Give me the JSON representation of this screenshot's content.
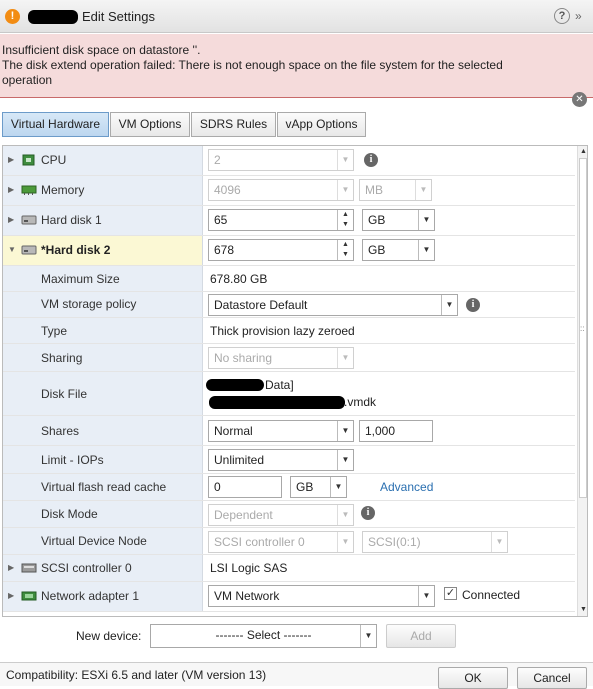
{
  "window": {
    "title": "Edit Settings"
  },
  "error": {
    "line1": "Insufficient disk space on datastore ''.",
    "line2": "The disk extend operation failed: There is not enough space on the file system for the selected operation"
  },
  "tabs": [
    "Virtual Hardware",
    "VM Options",
    "SDRS Rules",
    "vApp Options"
  ],
  "hardware": {
    "cpu": {
      "label": "CPU",
      "value": "2"
    },
    "memory": {
      "label": "Memory",
      "value": "4096",
      "unit": "MB"
    },
    "hard_disk_1": {
      "label": "Hard disk 1",
      "value": "65",
      "unit": "GB"
    },
    "hard_disk_2": {
      "label": "*Hard disk 2",
      "value": "678",
      "unit": "GB",
      "max_size_label": "Maximum Size",
      "max_size_value": "678.80 GB",
      "storage_policy_label": "VM storage policy",
      "storage_policy_value": "Datastore Default",
      "type_label": "Type",
      "type_value": "Thick provision lazy zeroed",
      "sharing_label": "Sharing",
      "sharing_value": "No sharing",
      "disk_file_label": "Disk File",
      "disk_file_line1": "Data]",
      "disk_file_line2": ".vmdk",
      "shares_label": "Shares",
      "shares_value": "Normal",
      "shares_number": "1,000",
      "limit_label": "Limit - IOPs",
      "limit_value": "Unlimited",
      "flash_label": "Virtual flash read cache",
      "flash_value": "0",
      "flash_unit": "GB",
      "advanced_link": "Advanced",
      "disk_mode_label": "Disk Mode",
      "disk_mode_value": "Dependent",
      "vdn_label": "Virtual Device Node",
      "vdn_controller": "SCSI controller 0",
      "vdn_slot": "SCSI(0:1)"
    },
    "scsi": {
      "label": "SCSI controller 0",
      "value": "LSI Logic SAS"
    },
    "network": {
      "label": "Network adapter 1",
      "value": "VM Network",
      "connected_label": "Connected"
    }
  },
  "new_device": {
    "label": "New device:",
    "select_value": "------- Select -------",
    "add_button": "Add"
  },
  "footer": {
    "compatibility": "Compatibility: ESXi 6.5 and later (VM version 13)",
    "ok_button": "OK",
    "cancel_button": "Cancel"
  }
}
